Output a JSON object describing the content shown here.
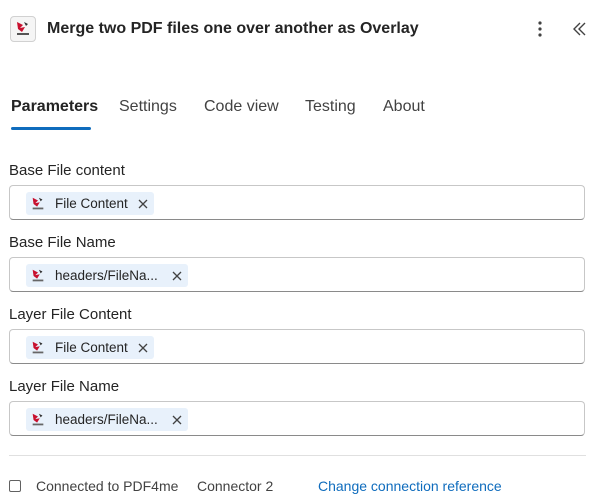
{
  "header": {
    "title": "Merge two PDF files one over another as Overlay",
    "app_icon": "pdf4me-logo",
    "more_icon": "more-vertical-icon",
    "collapse_icon": "double-chevron-left-icon"
  },
  "tabs": [
    {
      "label": "Parameters",
      "active": true
    },
    {
      "label": "Settings",
      "active": false
    },
    {
      "label": "Code view",
      "active": false
    },
    {
      "label": "Testing",
      "active": false
    },
    {
      "label": "About",
      "active": false
    }
  ],
  "fields": [
    {
      "label": "Base File content",
      "token": "File Content"
    },
    {
      "label": "Base File Name",
      "token": "headers/FileNa..."
    },
    {
      "label": "Layer File Content",
      "token": "File Content"
    },
    {
      "label": "Layer File Name",
      "token": "headers/FileNa..."
    }
  ],
  "footer": {
    "checkbox_label": "Connected to PDF4me",
    "connector_text": "Connector 2",
    "link_text": "Change connection reference"
  },
  "colors": {
    "accent": "#0f6cbd",
    "token_bg": "#e8f1fb",
    "logo_red": "#c8102e"
  }
}
